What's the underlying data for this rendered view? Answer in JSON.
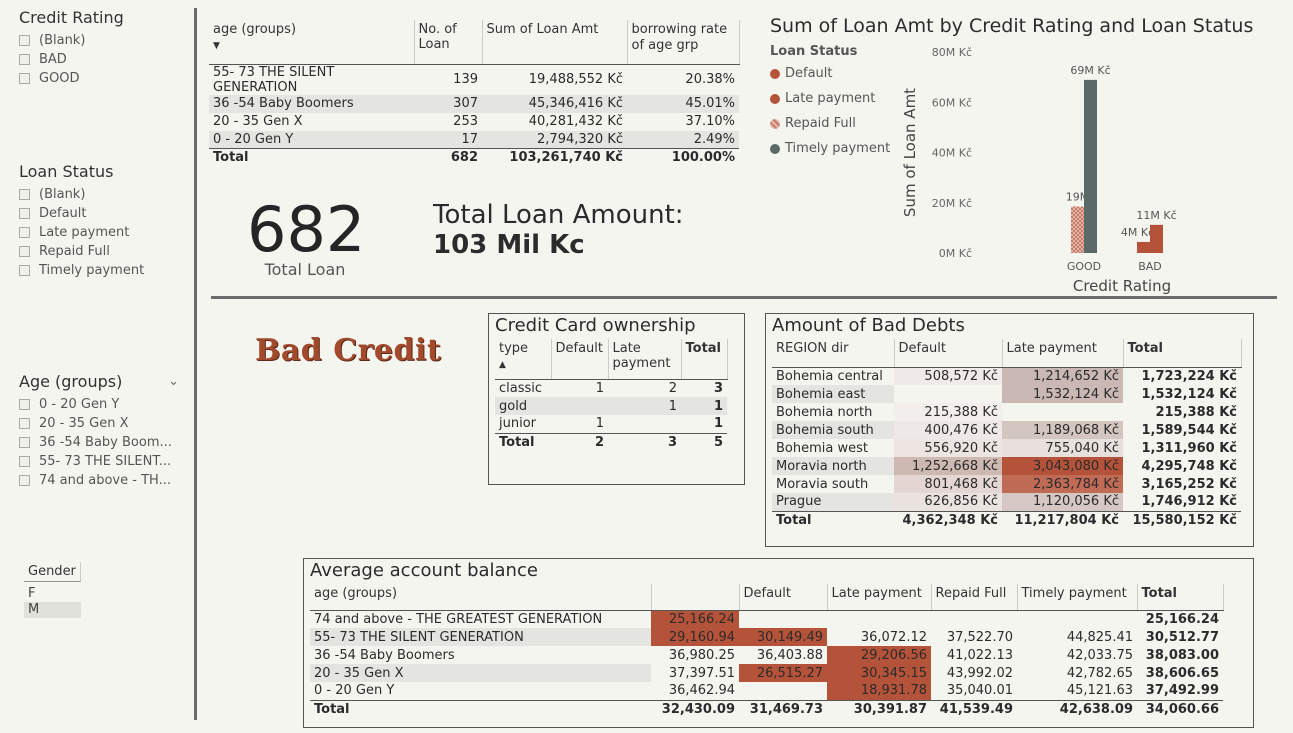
{
  "slicers": {
    "credit_rating": {
      "title": "Credit Rating",
      "items": [
        "(Blank)",
        "BAD",
        "GOOD"
      ]
    },
    "loan_status": {
      "title": "Loan Status",
      "items": [
        "(Blank)",
        "Default",
        "Late payment",
        "Repaid Full",
        "Timely payment"
      ]
    },
    "age_groups": {
      "title": "Age (groups)",
      "items": [
        "0 - 20 Gen Y",
        "20 - 35 Gen X",
        "36 -54 Baby Boom...",
        "55- 73 THE SILENT...",
        "74 and above - TH..."
      ]
    },
    "gender": {
      "title": "Gender",
      "items": [
        "F",
        "M"
      ]
    }
  },
  "age_table": {
    "headers": [
      "age (groups)",
      "No. of Loan",
      "Sum of Loan Amt",
      "borrowing rate of age grp"
    ],
    "rows": [
      [
        "55- 73 THE SILENT GENERATION",
        "139",
        "19,488,552 Kč",
        "20.38%"
      ],
      [
        "36 -54 Baby Boomers",
        "307",
        "45,346,416 Kč",
        "45.01%"
      ],
      [
        "20 - 35 Gen X",
        "253",
        "40,281,432 Kč",
        "37.10%"
      ],
      [
        "0 - 20 Gen Y",
        "17",
        "2,794,320 Kč",
        "2.49%"
      ]
    ],
    "total": [
      "Total",
      "682",
      "103,261,740 Kč",
      "100.00%"
    ]
  },
  "kpi": {
    "total_loan_value": "682",
    "total_loan_label": "Total Loan",
    "loan_amount_title": "Total Loan Amount:",
    "loan_amount_value": "103 Mil Kc"
  },
  "bad_credit_label": "Bad Credit",
  "credit_card": {
    "title": "Credit Card ownership",
    "headers": [
      "type",
      "Default",
      "Late payment",
      "Total"
    ],
    "rows": [
      [
        "classic",
        "1",
        "2",
        "3"
      ],
      [
        "gold",
        "",
        "1",
        "1"
      ],
      [
        "junior",
        "1",
        "",
        "1"
      ]
    ],
    "total": [
      "Total",
      "2",
      "3",
      "5"
    ]
  },
  "bad_debts": {
    "title": "Amount of Bad Debts",
    "headers": [
      "REGION dir",
      "Default",
      "Late payment",
      "Total"
    ],
    "rows": [
      [
        "Bohemia central",
        "508,572 Kč",
        "1,214,652 Kč",
        "1,723,224 Kč"
      ],
      [
        "Bohemia east",
        "",
        "1,532,124 Kč",
        "1,532,124 Kč"
      ],
      [
        "Bohemia north",
        "215,388 Kč",
        "",
        "215,388 Kč"
      ],
      [
        "Bohemia south",
        "400,476 Kč",
        "1,189,068 Kč",
        "1,589,544 Kč"
      ],
      [
        "Bohemia west",
        "556,920 Kč",
        "755,040 Kč",
        "1,311,960 Kč"
      ],
      [
        "Moravia north",
        "1,252,668 Kč",
        "3,043,080 Kč",
        "4,295,748 Kč"
      ],
      [
        "Moravia south",
        "801,468 Kč",
        "2,363,784 Kč",
        "3,165,252 Kč"
      ],
      [
        "Prague",
        "626,856 Kč",
        "1,120,056 Kč",
        "1,746,912 Kč"
      ]
    ],
    "total": [
      "Total",
      "4,362,348 Kč",
      "11,217,804 Kč",
      "15,580,152 Kč"
    ]
  },
  "avg_balance": {
    "title": "Average account balance",
    "headers": [
      "age (groups)",
      "",
      "Default",
      "Late payment",
      "Repaid Full",
      "Timely payment",
      "Total"
    ],
    "rows": [
      [
        "74 and above - THE GREATEST GENERATION",
        "25,166.24",
        "",
        "",
        "",
        "",
        "25,166.24"
      ],
      [
        "55- 73 THE SILENT GENERATION",
        "29,160.94",
        "30,149.49",
        "36,072.12",
        "37,522.70",
        "44,825.41",
        "30,512.77"
      ],
      [
        "36 -54 Baby Boomers",
        "36,980.25",
        "36,403.88",
        "29,206.56",
        "41,022.13",
        "42,033.75",
        "38,083.00"
      ],
      [
        "20 - 35 Gen X",
        "37,397.51",
        "26,515.27",
        "30,345.15",
        "43,992.02",
        "42,782.65",
        "38,606.65"
      ],
      [
        "0 - 20 Gen Y",
        "36,462.94",
        "",
        "18,931.78",
        "35,040.01",
        "45,121.63",
        "37,492.99"
      ]
    ],
    "total": [
      "Total",
      "32,430.09",
      "31,469.73",
      "30,391.87",
      "41,539.49",
      "42,638.09",
      "34,060.66"
    ]
  },
  "chart": {
    "title": "Sum of Loan Amt by Credit Rating and Loan Status",
    "legend_title": "Loan Status",
    "legend": [
      {
        "name": "Default",
        "color": "#b5533a"
      },
      {
        "name": "Late payment",
        "color": "#b5533a"
      },
      {
        "name": "Repaid Full",
        "color": "#c77a66"
      },
      {
        "name": "Timely payment",
        "color": "#5a6a68"
      }
    ],
    "xlabel": "Credit Rating",
    "ylabel": "Sum of Loan Amt"
  },
  "chart_data": {
    "type": "bar",
    "categories": [
      "GOOD",
      "BAD"
    ],
    "ylim": [
      0,
      80
    ],
    "yticks": [
      "0M Kč",
      "20M Kč",
      "40M Kč",
      "60M Kč",
      "80M Kč"
    ],
    "series": [
      {
        "name": "Default",
        "values": [
          null,
          4.4
        ],
        "color": "#b5533a"
      },
      {
        "name": "Late payment",
        "values": [
          null,
          11.2
        ],
        "color": "#b5533a"
      },
      {
        "name": "Repaid Full",
        "values": [
          18.5,
          null
        ],
        "color": "#c77a66"
      },
      {
        "name": "Timely payment",
        "values": [
          68.9,
          null
        ],
        "color": "#5a6a68"
      }
    ],
    "data_labels": [
      {
        "category": "GOOD",
        "series": "Repaid Full",
        "text": "19M"
      },
      {
        "category": "GOOD",
        "series": "Timely payment",
        "text": "69M Kč"
      },
      {
        "category": "BAD",
        "series": "Default",
        "text": "4M Kč"
      },
      {
        "category": "BAD",
        "series": "Late payment",
        "text": "11M Kč"
      }
    ]
  },
  "colors": {
    "heat_strong": "#b5533a",
    "heat_mid": "#c98f80",
    "heat_light": "#d7c4be",
    "row_shade": "#e4e4e0"
  }
}
